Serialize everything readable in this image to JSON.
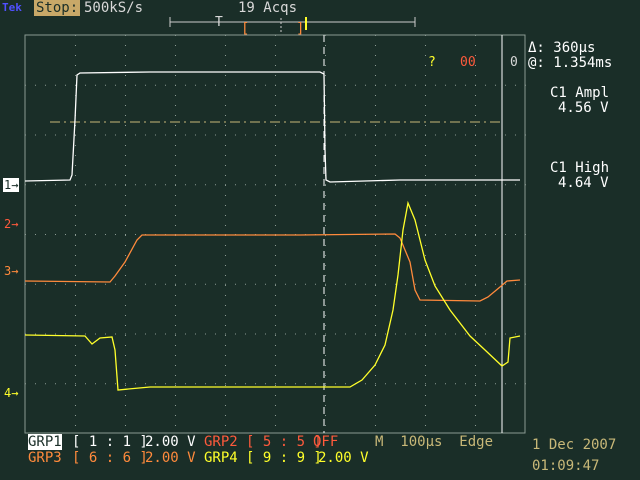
{
  "top_bar": {
    "brand": "Tek",
    "run_state": "Stop:",
    "sample_rate": "500kS/s",
    "acquisitions": "19 Acqs",
    "trigger_marker": "T"
  },
  "cursor_readout": {
    "question": "?",
    "count": "00",
    "zero": "0",
    "delta": "Δ: 360µs",
    "at": "@: 1.354ms"
  },
  "measurements": [
    {
      "label": "C1 Ampl",
      "value": "4.56 V"
    },
    {
      "label": "C1 High",
      "value": "4.64 V"
    }
  ],
  "channel_markers": [
    "1",
    "2",
    "3",
    "4"
  ],
  "bottom_bar": {
    "row1": {
      "grp1_name": "GRP1",
      "grp1_range": "[ 1 : 1 ]",
      "grp1_scale": "2.00 V",
      "grp2_name": "GRP2",
      "grp2_range": "[ 5 : 5 ]",
      "grp2_state": "OFF",
      "timebase": "M  100µs  Edge"
    },
    "row2": {
      "grp3_name": "GRP3",
      "grp3_range": "[ 6 : 6 ]",
      "grp3_scale": "2.00 V",
      "grp4_name": "GRP4",
      "grp4_range": "[ 9 : 9 ]",
      "grp4_scale": "2.00 V"
    },
    "date": "1 Dec 2007",
    "time": "01:09:47"
  },
  "colors": {
    "background": "#1a2e28",
    "grid": "#8a9a92",
    "ch1": "#ffffff",
    "ch2": "#ff5a3c",
    "ch3": "#ff8a3c",
    "ch4": "#ffff2a",
    "dashed_level": "#c8b878"
  }
}
